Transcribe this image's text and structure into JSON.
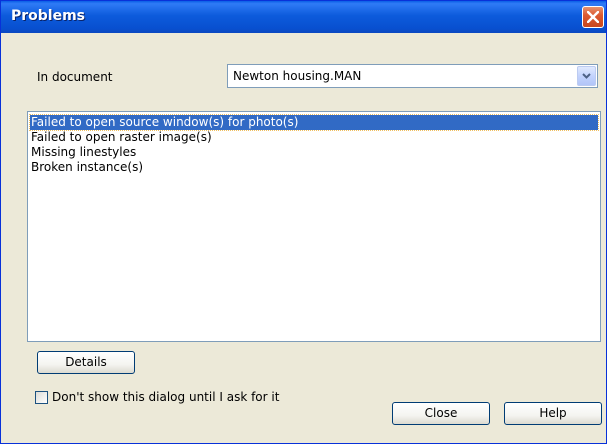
{
  "window": {
    "title": "Problems"
  },
  "document_field": {
    "label": "In document",
    "value": "Newton housing.MAN"
  },
  "problems_list": {
    "items": [
      {
        "label": "Failed to open source window(s) for photo(s)",
        "selected": true
      },
      {
        "label": "Failed to open raster image(s)",
        "selected": false
      },
      {
        "label": "Missing linestyles",
        "selected": false
      },
      {
        "label": "Broken instance(s)",
        "selected": false
      }
    ]
  },
  "buttons": {
    "details": "Details",
    "close": "Close",
    "help": "Help"
  },
  "options": {
    "dont_show_label": "Don't show this dialog until I ask for it",
    "dont_show_checked": false
  },
  "colors": {
    "titlebar": "#0a5fe6",
    "selection": "#316ac5",
    "dialog_bg": "#ece9d8"
  }
}
